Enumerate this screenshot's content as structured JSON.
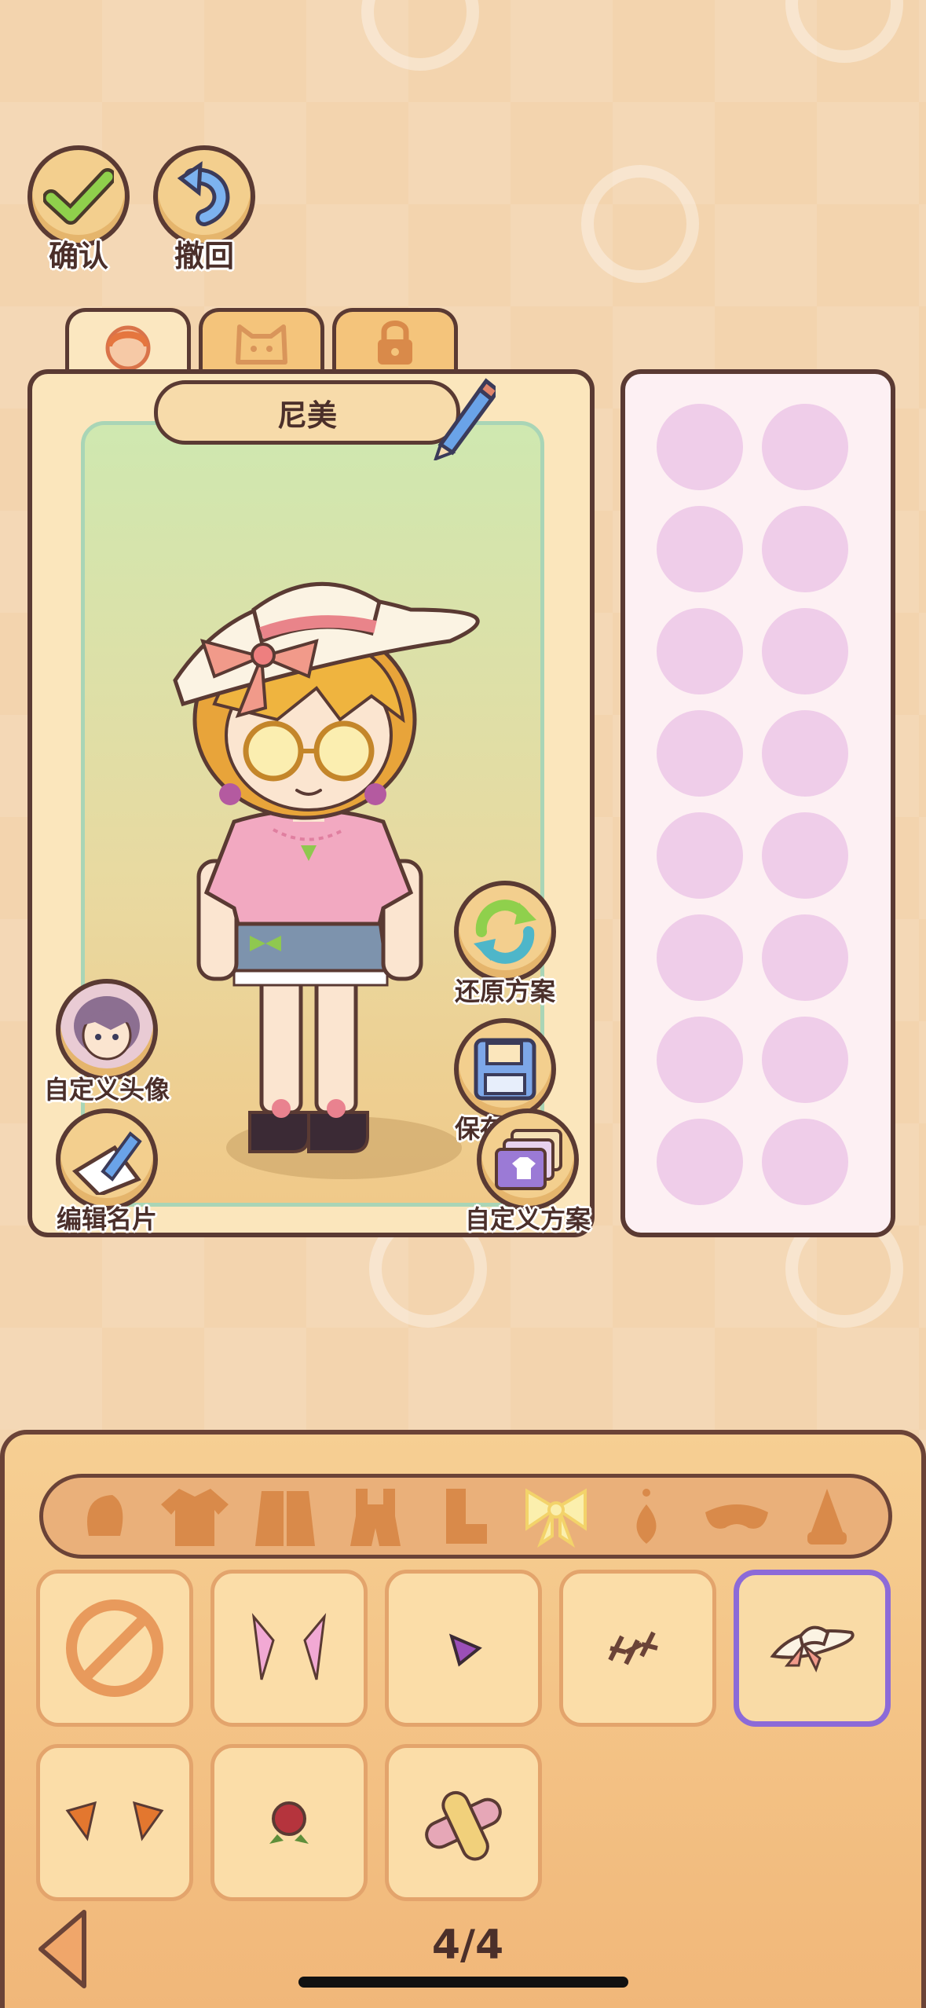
{
  "top_buttons": {
    "confirm_label": "确认",
    "undo_label": "撤回"
  },
  "tabs": [
    {
      "icon": "character-face-icon",
      "active": true
    },
    {
      "icon": "cat-face-icon",
      "active": false
    },
    {
      "icon": "lock-icon",
      "active": false
    }
  ],
  "character": {
    "name": "尼美"
  },
  "side_actions": {
    "custom_avatar": "自定义头像",
    "edit_card": "编辑名片",
    "restore_outfit": "还原方案",
    "save_outfit": "保存方案",
    "custom_outfit": "自定义方案"
  },
  "slots": {
    "count": 16,
    "color": "#efcde9"
  },
  "categories": [
    {
      "icon": "hair-icon",
      "active": false
    },
    {
      "icon": "shirt-icon",
      "active": false
    },
    {
      "icon": "jacket-icon",
      "active": false
    },
    {
      "icon": "overalls-icon",
      "active": false
    },
    {
      "icon": "boots-icon",
      "active": false
    },
    {
      "icon": "bow-icon",
      "active": true
    },
    {
      "icon": "earring-icon",
      "active": false
    },
    {
      "icon": "mask-icon",
      "active": false
    },
    {
      "icon": "gnome-hat-icon",
      "active": false
    }
  ],
  "items": [
    {
      "icon": "none-icon",
      "selected": false
    },
    {
      "icon": "pink-ribbons-icon",
      "selected": false
    },
    {
      "icon": "purple-hairclip-icon",
      "selected": false
    },
    {
      "icon": "hairpins-icon",
      "selected": false
    },
    {
      "icon": "sun-hat-icon",
      "selected": true
    },
    {
      "icon": "fox-ears-icon",
      "selected": false
    },
    {
      "icon": "rose-icon",
      "selected": false
    },
    {
      "icon": "bandage-icon",
      "selected": false
    }
  ],
  "pagination": {
    "page_label": "4/4"
  },
  "colors": {
    "accent": "#8c6ad8",
    "outline": "#5a3a33",
    "panel": "#fbe6bc"
  }
}
